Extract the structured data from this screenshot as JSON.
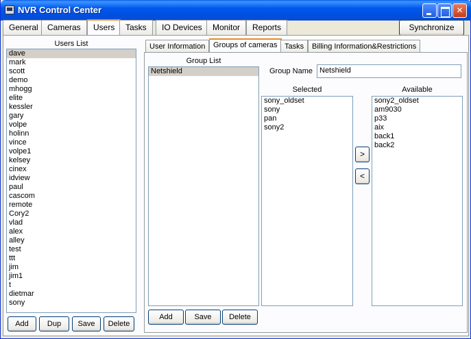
{
  "window": {
    "title": "NVR Control Center"
  },
  "main_tabs": [
    {
      "label": "General"
    },
    {
      "label": "Cameras"
    },
    {
      "label": "Users"
    },
    {
      "label": "Tasks"
    },
    {
      "label": "IO Devices"
    },
    {
      "label": "Monitor"
    },
    {
      "label": "Reports"
    }
  ],
  "synchronize_label": "Synchronize",
  "users_panel": {
    "title": "Users List",
    "users": [
      "dave",
      "mark",
      "scott",
      "demo",
      "mhogg",
      "elite",
      "kessler",
      "gary",
      "volpe",
      "holinn",
      "vince",
      "volpe1",
      "kelsey",
      "cinex",
      "idview",
      "paul",
      "cascom",
      "remote",
      "Cory2",
      "vlad",
      "alex",
      "alley",
      "test",
      "ttt",
      "jim",
      "jim1",
      "t",
      "dietmar",
      "sony"
    ],
    "selected": "dave",
    "buttons": {
      "add": "Add",
      "dup": "Dup",
      "save": "Save",
      "delete": "Delete"
    }
  },
  "sub_tabs": [
    {
      "label": "User Information"
    },
    {
      "label": "Groups of cameras"
    },
    {
      "label": "Tasks"
    },
    {
      "label": "Billing Information&Restrictions"
    }
  ],
  "groups": {
    "list_title": "Group List",
    "items": [
      "Netshield"
    ],
    "selected": "Netshield",
    "group_name_label": "Group Name",
    "group_name_value": "Netshield",
    "selected_title": "Selected",
    "selected_cameras": [
      "sony_oldset",
      "sony",
      "pan",
      "sony2"
    ],
    "available_title": "Available",
    "available_cameras": [
      "sony2_oldset",
      "am9030",
      "p33",
      "aix",
      "back1",
      "back2"
    ],
    "move_right": ">",
    "move_left": "<",
    "buttons": {
      "add": "Add",
      "save": "Save",
      "delete": "Delete"
    }
  }
}
